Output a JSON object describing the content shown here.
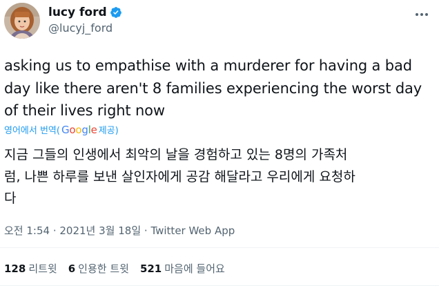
{
  "user": {
    "display_name": "lucy ford",
    "handle": "@lucyj_ford",
    "verified": true,
    "avatar_icon": "profile-photo"
  },
  "tweet": {
    "text": "asking us to empathise with a murderer for having a bad\nday like there aren't 8 families experiencing the worst day\nof their lives right now",
    "translate_label_pre": "영어에서 번역(",
    "translate_label_post": " 제공)",
    "translate_provider": "Google",
    "translated_text": "지금 그들의 인생에서 최악의 날을 경험하고 있는 8명의 가족처\n럼, 나쁜 하루를 보낸 살인자에게 공감 해달라고 우리에게 요청하\n다",
    "time": "오전 1:54",
    "sep1": " · ",
    "date": "2021년 3월 18일",
    "sep2": " · ",
    "source": "Twitter Web App"
  },
  "stats": {
    "retweets_count": "128",
    "retweets_label": "리트윗",
    "quotes_count": "6",
    "quotes_label": "인용한 트윗",
    "likes_count": "521",
    "likes_label": "마음에 들어요"
  },
  "colors": {
    "accent": "#1d9bf0",
    "text": "#0f1419",
    "secondary": "#536471"
  }
}
